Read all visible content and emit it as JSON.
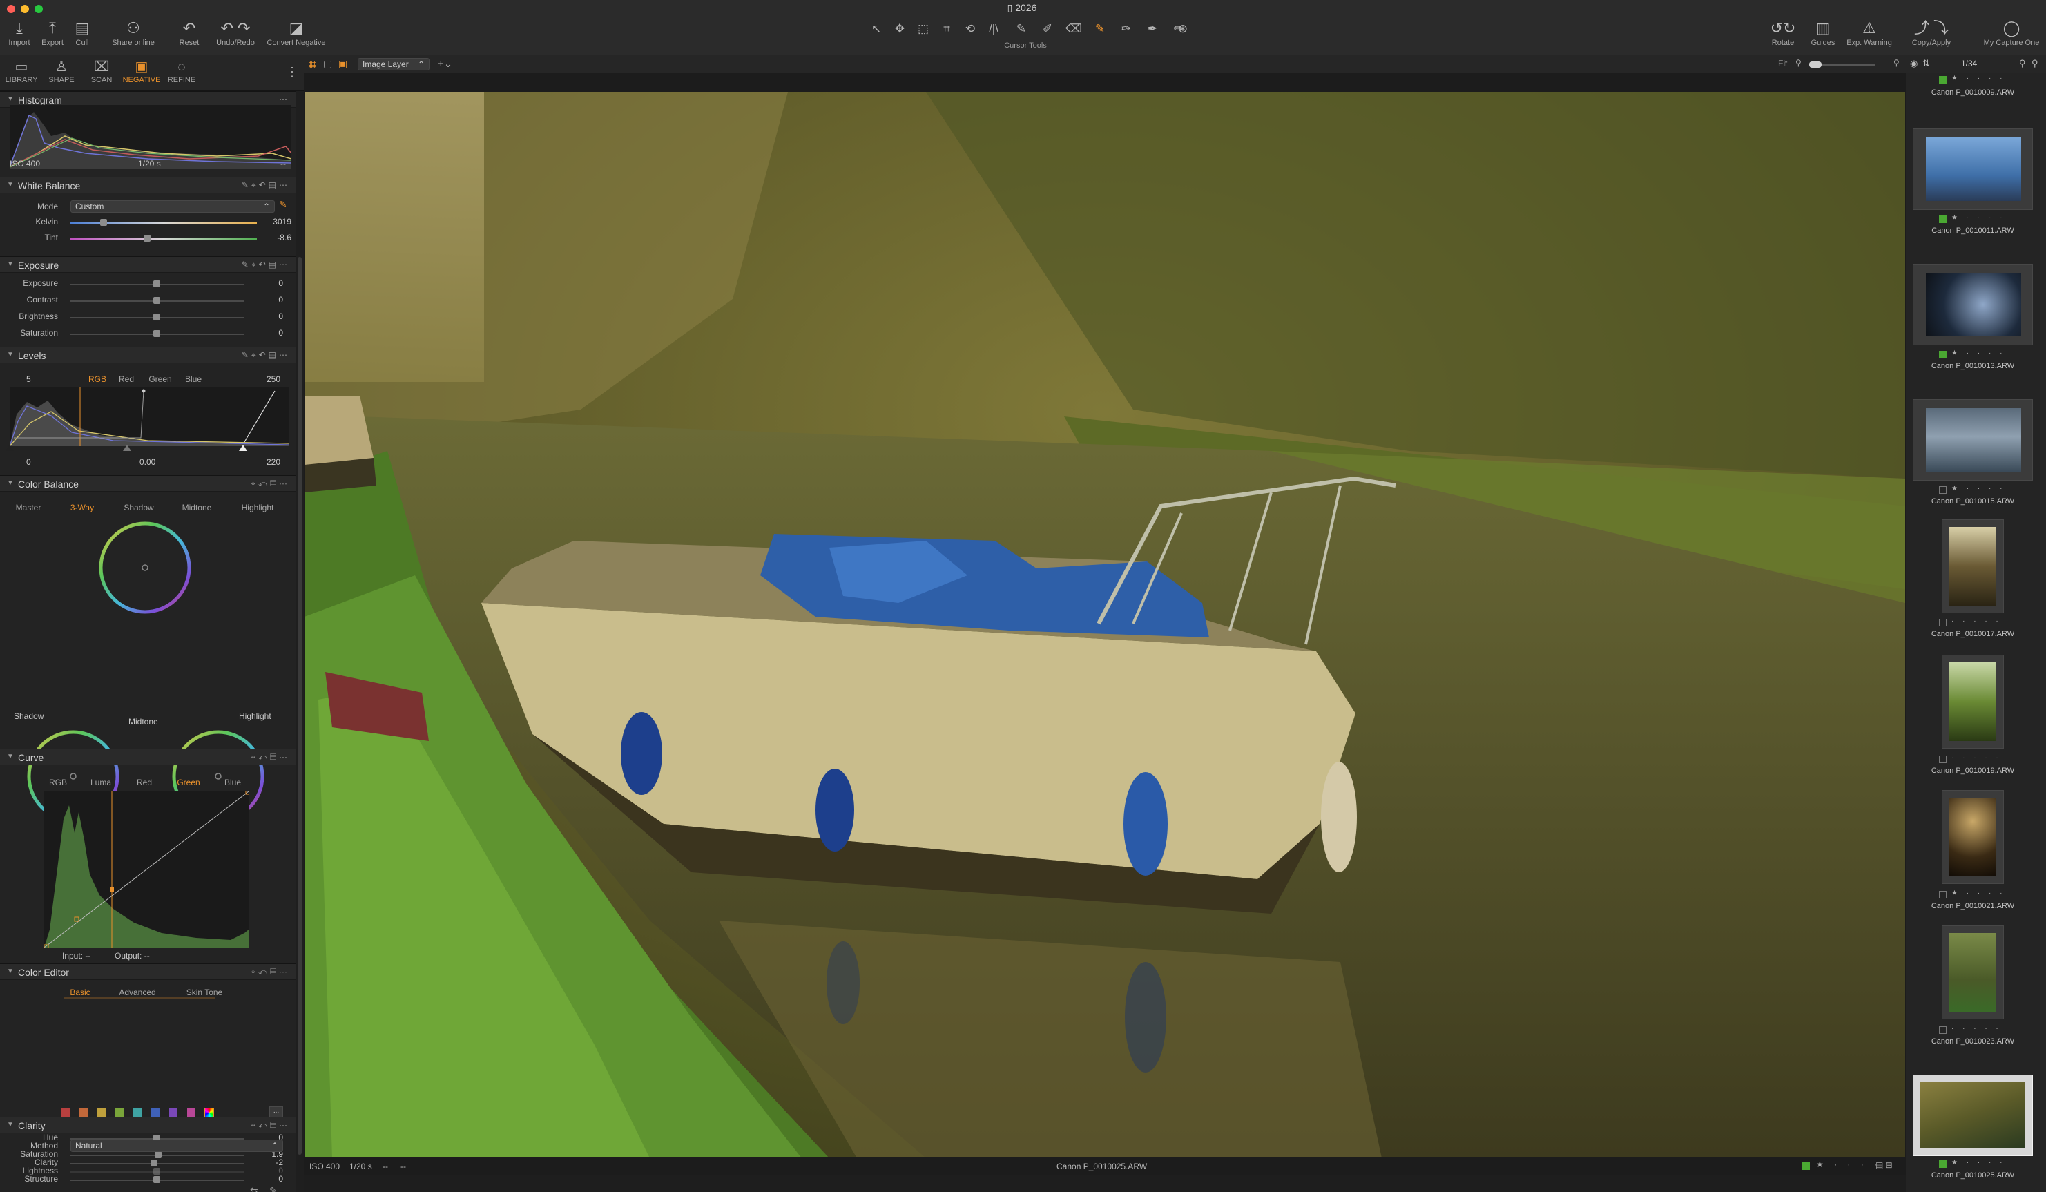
{
  "window": {
    "title": "2026"
  },
  "toolbar": {
    "left_buttons": [
      {
        "label": "Import",
        "icon": "import-icon"
      },
      {
        "label": "Export",
        "icon": "export-icon"
      },
      {
        "label": "Cull",
        "icon": "cull-icon"
      },
      {
        "label": "Share online",
        "icon": "share-icon"
      },
      {
        "label": "Reset",
        "icon": "reset-icon"
      },
      {
        "label": "Undo/Redo",
        "icon": "undo-redo-icon"
      },
      {
        "label": "Convert Negative",
        "icon": "convert-negative-icon"
      }
    ],
    "cursor_tools_label": "Cursor Tools",
    "right_buttons": [
      {
        "label": "Rotate"
      },
      {
        "label": "Guides"
      },
      {
        "label": "Exp. Warning"
      },
      {
        "label": "Copy/Apply"
      },
      {
        "label": "My Capture One"
      }
    ]
  },
  "tool_tabs": [
    {
      "label": "LIBRARY"
    },
    {
      "label": "SHAPE"
    },
    {
      "label": "SCAN"
    },
    {
      "label": "NEGATIVE",
      "active": true
    },
    {
      "label": "REFINE"
    }
  ],
  "histogram": {
    "title": "Histogram",
    "iso": "ISO 400",
    "shutter": "1/20 s",
    "extra": "--"
  },
  "white_balance": {
    "title": "White Balance",
    "mode_label": "Mode",
    "mode_value": "Custom",
    "kelvin_label": "Kelvin",
    "kelvin_value": "3019",
    "tint_label": "Tint",
    "tint_value": "-8.6"
  },
  "exposure": {
    "title": "Exposure",
    "rows": [
      {
        "label": "Exposure",
        "value": "0"
      },
      {
        "label": "Contrast",
        "value": "0"
      },
      {
        "label": "Brightness",
        "value": "0"
      },
      {
        "label": "Saturation",
        "value": "0"
      }
    ]
  },
  "levels": {
    "title": "Levels",
    "tabs": [
      "RGB",
      "Red",
      "Green",
      "Blue"
    ],
    "active_tab": "RGB",
    "top_left": "5",
    "top_right": "250",
    "bottom_left": "0",
    "bottom_mid": "0.00",
    "bottom_right": "220"
  },
  "color_balance": {
    "title": "Color Balance",
    "tabs": [
      "Master",
      "3-Way",
      "Shadow",
      "Midtone",
      "Highlight"
    ],
    "active_tab": "3-Way",
    "wheel_labels": {
      "shadow": "Shadow",
      "midtone": "Midtone",
      "highlight": "Highlight"
    }
  },
  "curve": {
    "title": "Curve",
    "tabs": [
      "RGB",
      "Luma",
      "Red",
      "Green",
      "Blue"
    ],
    "active_tab": "Green",
    "input_label": "Input: --",
    "output_label": "Output: --"
  },
  "color_editor": {
    "title": "Color Editor",
    "tabs": [
      "Basic",
      "Advanced",
      "Skin Tone"
    ],
    "active_tab": "Basic",
    "swatches": [
      "#b8403f",
      "#c2683a",
      "#bfa03c",
      "#7aa53a",
      "#3fa3a3",
      "#3f61b8",
      "#7a48b8",
      "#b84797"
    ],
    "more": "...",
    "rows": [
      {
        "label": "Hue",
        "value": "0"
      },
      {
        "label": "Saturation",
        "value": "1.9"
      },
      {
        "label": "Lightness",
        "value": "0"
      }
    ]
  },
  "clarity": {
    "title": "Clarity",
    "method_label": "Method",
    "method_value": "Natural",
    "rows": [
      {
        "label": "Clarity",
        "value": "-2"
      },
      {
        "label": "Structure",
        "value": "0"
      }
    ]
  },
  "viewer": {
    "layer": "Image Layer",
    "zoom": "Fit",
    "status_iso": "ISO 400",
    "status_shutter": "1/20 s",
    "status_a": "--",
    "status_b": "--",
    "filename": "Canon P_0010025.ARW"
  },
  "browser": {
    "counter": "1/34",
    "items": [
      {
        "name": "Canon P_0010009.ARW",
        "tag": "green"
      },
      {
        "name": "Canon P_0010011.ARW",
        "tag": "green"
      },
      {
        "name": "Canon P_0010013.ARW",
        "tag": "green"
      },
      {
        "name": "Canon P_0010015.ARW",
        "tag": "none"
      },
      {
        "name": "Canon P_0010017.ARW",
        "tag": "none"
      },
      {
        "name": "Canon P_0010019.ARW",
        "tag": "none"
      },
      {
        "name": "Canon P_0010021.ARW",
        "tag": "none"
      },
      {
        "name": "Canon P_0010023.ARW",
        "tag": "none"
      },
      {
        "name": "Canon P_0010025.ARW",
        "tag": "green",
        "selected": true
      }
    ]
  },
  "colors": {
    "accent": "#e9912c",
    "tag_green": "#4aa832"
  }
}
